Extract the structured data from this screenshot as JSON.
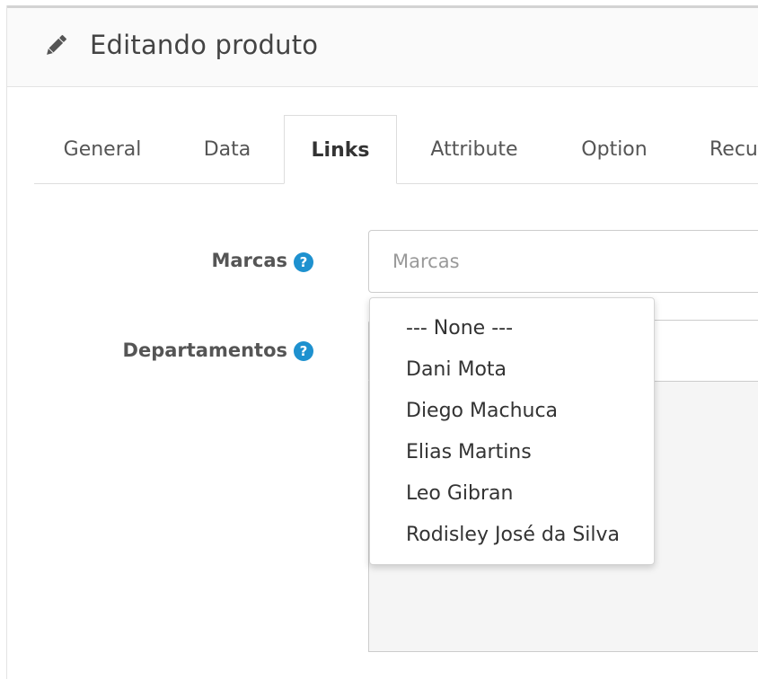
{
  "header": {
    "title": "Editando produto",
    "icon": "pencil-icon"
  },
  "tabs": [
    {
      "label": "General"
    },
    {
      "label": "Data"
    },
    {
      "label": "Links",
      "active": true
    },
    {
      "label": "Attribute"
    },
    {
      "label": "Option"
    },
    {
      "label": "Recu"
    }
  ],
  "form": {
    "marcas": {
      "label": "Marcas",
      "placeholder": "Marcas",
      "help_icon": "question-circle-icon"
    },
    "departamentos": {
      "label": "Departamentos",
      "help_icon": "question-circle-icon"
    }
  },
  "dropdown": {
    "items": [
      {
        "label": "--- None ---"
      },
      {
        "label": "Dani Mota"
      },
      {
        "label": "Diego Machuca"
      },
      {
        "label": "Elias Martins"
      },
      {
        "label": "Leo Gibran"
      },
      {
        "label": "Rodisley José da Silva"
      }
    ]
  },
  "colors": {
    "accent": "#1e91cf",
    "heading_bg": "#fafafa",
    "text": "#333333"
  }
}
